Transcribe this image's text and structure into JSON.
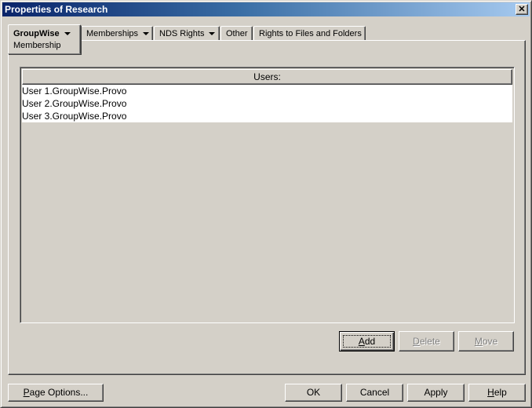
{
  "window": {
    "title": "Properties of Research",
    "close_glyph": "✕"
  },
  "tabs": [
    {
      "label": "GroupWise",
      "sub_label": "Membership",
      "has_dropdown": true,
      "active": true
    },
    {
      "label": "Memberships",
      "has_dropdown": true,
      "active": false
    },
    {
      "label": "NDS Rights",
      "has_dropdown": true,
      "active": false
    },
    {
      "label": "Other",
      "has_dropdown": false,
      "active": false
    },
    {
      "label": "Rights to Files and Folders",
      "has_dropdown": false,
      "active": false
    }
  ],
  "users_list": {
    "header": "Users:",
    "rows": [
      "User 1.GroupWise.Provo",
      "User 2.GroupWise.Provo",
      "User 3.GroupWise.Provo"
    ]
  },
  "list_buttons": {
    "add": {
      "pre": "",
      "accel": "A",
      "post": "dd",
      "enabled": true
    },
    "delete": {
      "pre": "",
      "accel": "D",
      "post": "elete",
      "enabled": false
    },
    "move": {
      "pre": "",
      "accel": "M",
      "post": "ove",
      "enabled": false
    }
  },
  "footer_buttons": {
    "page_options": {
      "pre": "",
      "accel": "P",
      "post": "age Options..."
    },
    "ok": {
      "label": "OK"
    },
    "cancel": {
      "label": "Cancel"
    },
    "apply": {
      "label": "Apply"
    },
    "help": {
      "pre": "",
      "accel": "H",
      "post": "elp"
    }
  }
}
